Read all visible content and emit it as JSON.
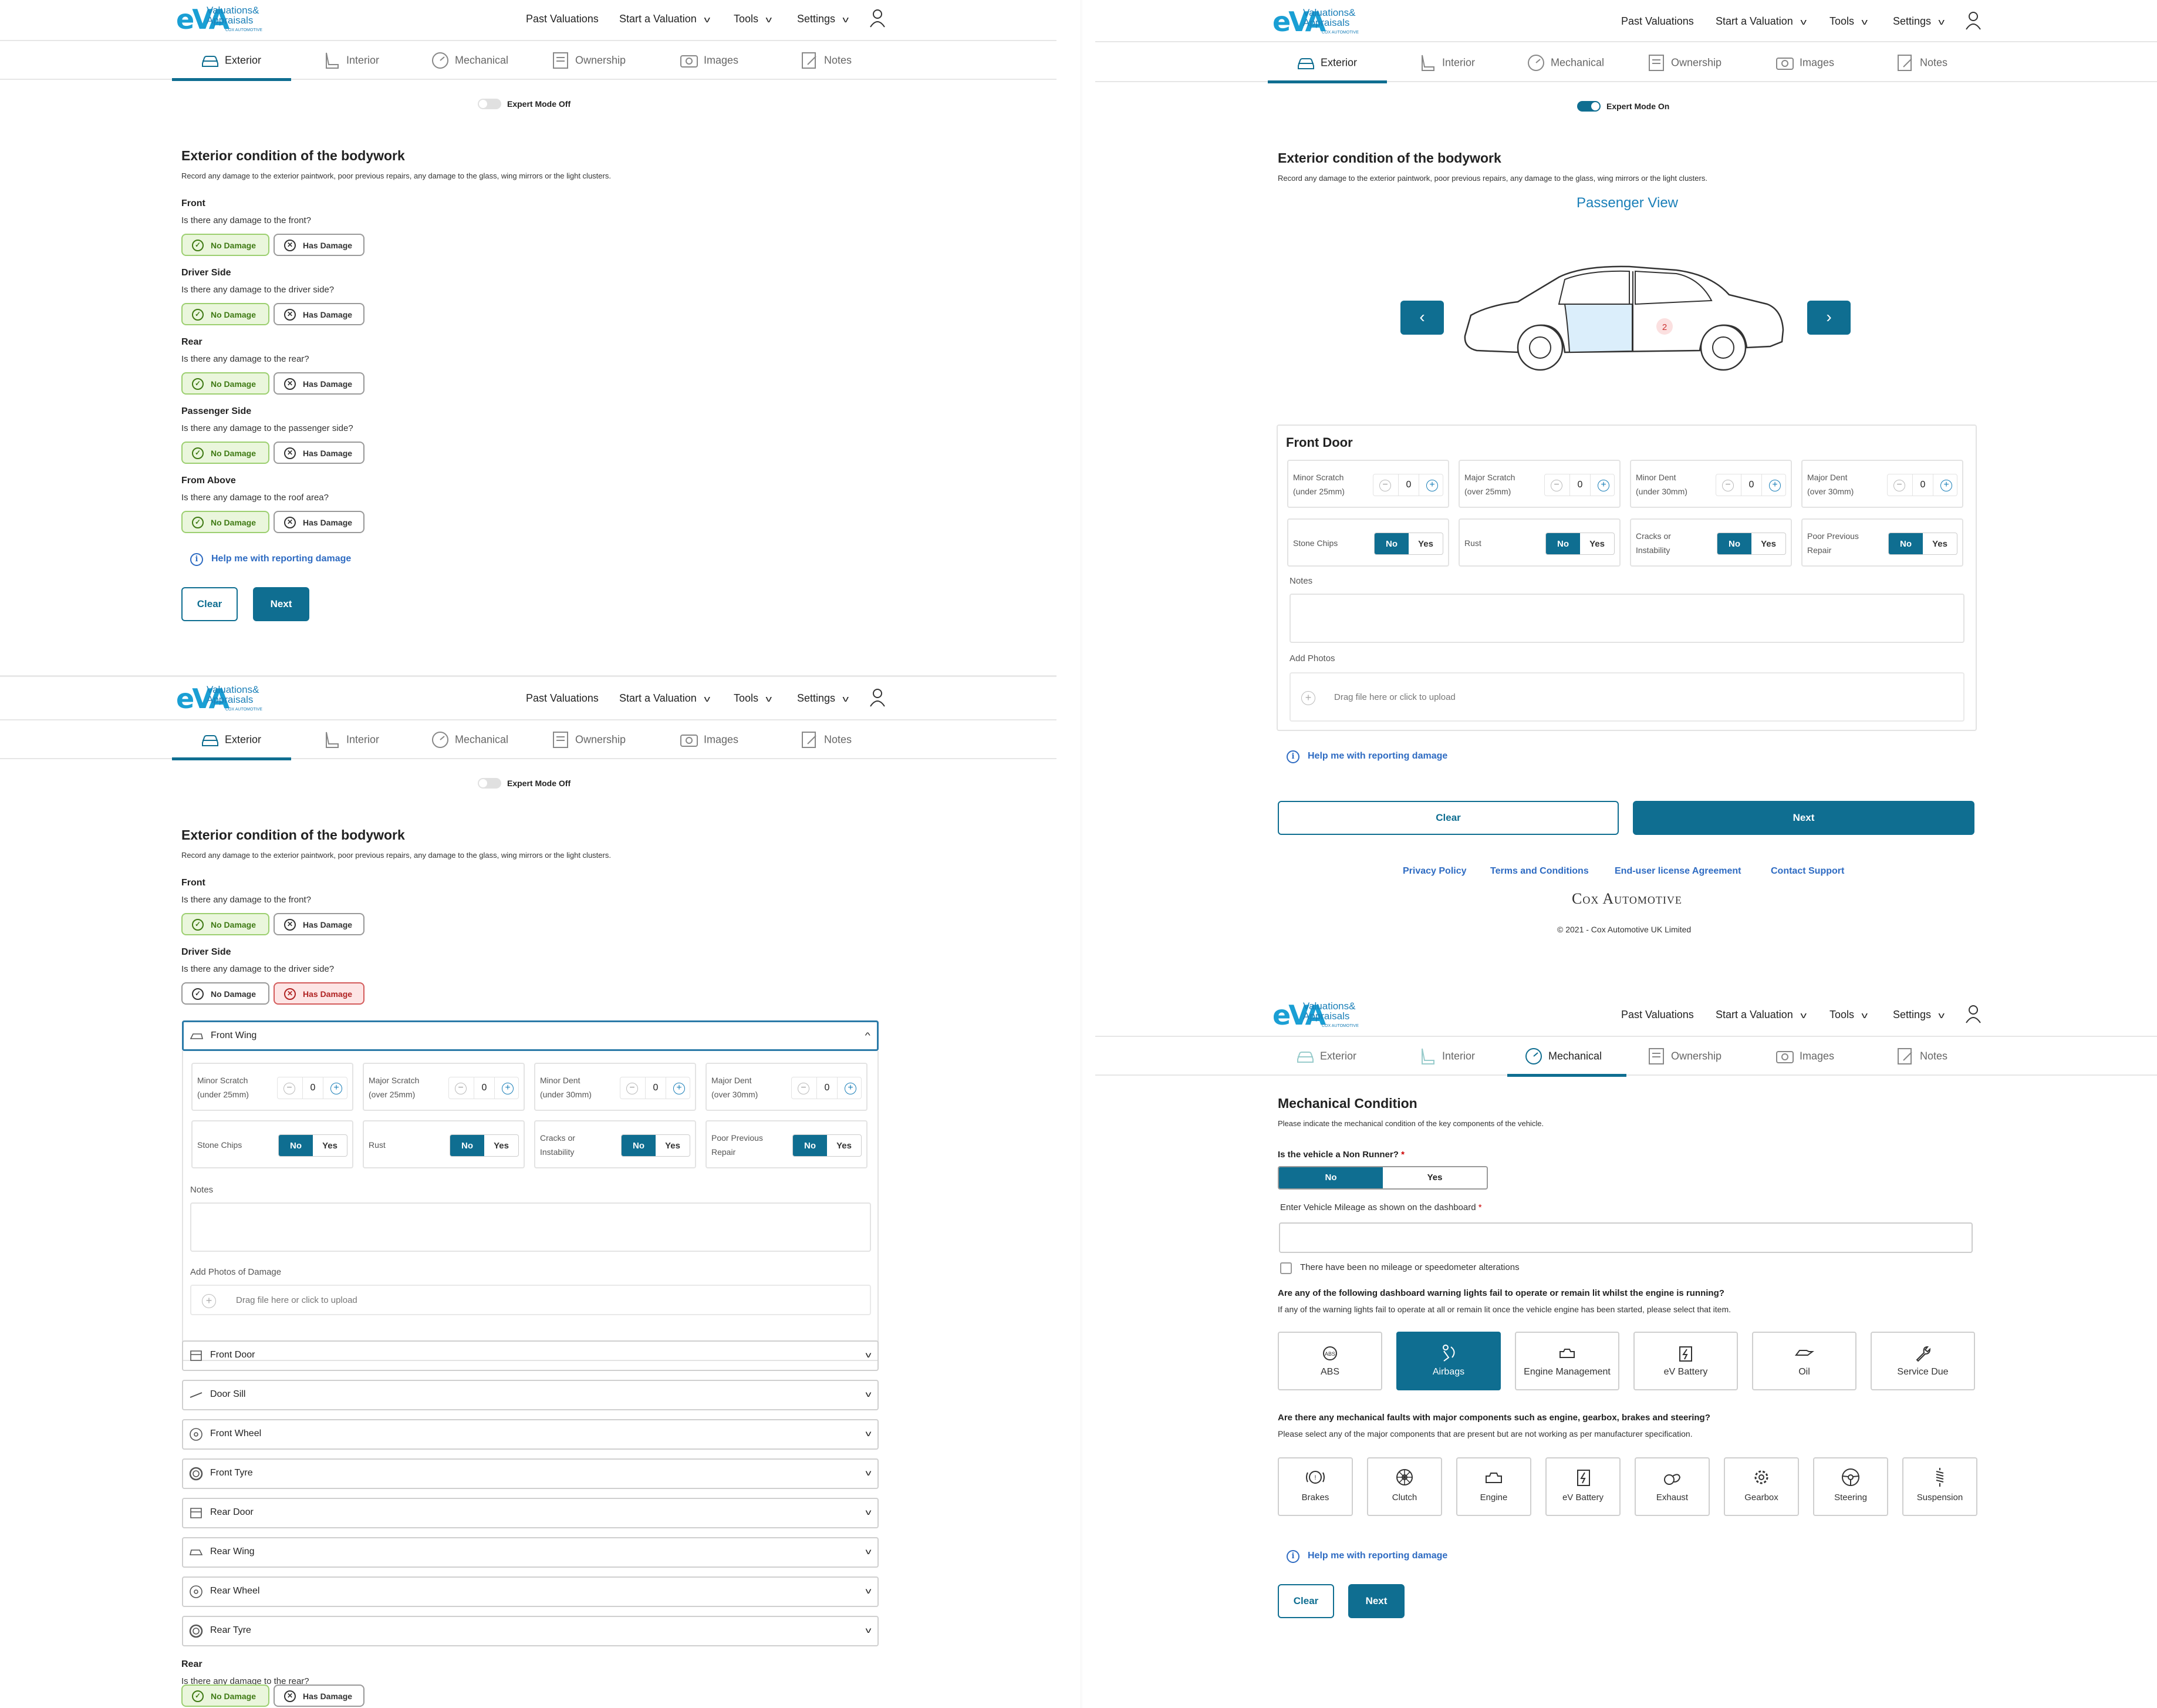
{
  "app": {
    "logo_mark": "eVA",
    "logo_text_1": "Valuations&",
    "logo_text_2": "Appraisals",
    "logo_sub": "COX AUTOMOTIVE"
  },
  "nav": {
    "past": "Past Valuations",
    "start": "Start a Valuation",
    "tools": "Tools",
    "settings": "Settings"
  },
  "tabs": {
    "exterior": "Exterior",
    "interior": "Interior",
    "mechanical": "Mechanical",
    "ownership": "Ownership",
    "images": "Images",
    "notes": "Notes"
  },
  "expert": {
    "off": "Expert Mode Off",
    "on": "Expert Mode On"
  },
  "exterior": {
    "title": "Exterior condition of the bodywork",
    "subtitle": "Record any damage to the exterior paintwork, poor previous repairs, any damage to the glass, wing mirrors or the light clusters.",
    "sections": [
      {
        "heading": "Front",
        "question": "Is there any damage to the front?"
      },
      {
        "heading": "Driver Side",
        "question": "Is there any damage to the driver side?"
      },
      {
        "heading": "Rear",
        "question": "Is there any damage to the rear?"
      },
      {
        "heading": "Passenger Side",
        "question": "Is there any damage to the passenger side?"
      },
      {
        "heading": "From Above",
        "question": "Is there any damage to the roof area?"
      }
    ],
    "no_damage": "No Damage",
    "has_damage": "Has Damage"
  },
  "help": "Help me with reporting damage",
  "clear": "Clear",
  "next": "Next",
  "damage_panel": {
    "counters": [
      {
        "l1": "Minor Scratch",
        "l2": "(under 25mm)",
        "value": "0"
      },
      {
        "l1": "Major Scratch",
        "l2": "(over 25mm)",
        "value": "0"
      },
      {
        "l1": "Minor Dent",
        "l2": "(under 30mm)",
        "value": "0"
      },
      {
        "l1": "Major Dent",
        "l2": "(over 30mm)",
        "value": "0"
      }
    ],
    "toggles": [
      {
        "l1": "Stone Chips",
        "l2": ""
      },
      {
        "l1": "Rust",
        "l2": ""
      },
      {
        "l1": "Cracks or",
        "l2": "Instability"
      },
      {
        "l1": "Poor Previous",
        "l2": "Repair"
      }
    ],
    "no": "No",
    "yes": "Yes",
    "notes": "Notes",
    "add_photos_damage": "Add Photos of Damage",
    "add_photos": "Add Photos",
    "upload": "Drag file here or click to upload"
  },
  "accordion": {
    "open": "Front Wing",
    "items": [
      "Front Door",
      "Door Sill",
      "Front Wheel",
      "Front Tyre",
      "Rear Door",
      "Rear Wing",
      "Rear Wheel",
      "Rear Tyre"
    ]
  },
  "car_view": {
    "title": "Passenger View",
    "panel": "Front Door",
    "marker": "2"
  },
  "footer": {
    "privacy": "Privacy Policy",
    "terms": "Terms and Conditions",
    "eula": "End-user license Agreement",
    "contact": "Contact Support",
    "brand": "Cox Automotive",
    "copyright": "© 2021 - Cox Automotive UK Limited"
  },
  "mechanical": {
    "title": "Mechanical Condition",
    "subtitle": "Please indicate the mechanical condition of the key components of the vehicle.",
    "non_runner_q": "Is the vehicle a Non Runner?",
    "req": "*",
    "no": "No",
    "yes": "Yes",
    "mileage_label": "Enter Vehicle Mileage as shown on the dashboard",
    "mileage_check": "There have been no mileage or speedometer alterations",
    "warn_q": "Are any of the following dashboard warning lights fail to operate or remain lit whilst the engine is running?",
    "warn_sub": "If any of the warning lights fail to operate at all or remain lit once the vehicle engine has been started, please select that item.",
    "warn_items": [
      {
        "label": "ABS",
        "icon": "abs-icon",
        "selected": false
      },
      {
        "label": "Airbags",
        "icon": "airbag-icon",
        "selected": true
      },
      {
        "label": "Engine Management",
        "icon": "engine-icon",
        "selected": false
      },
      {
        "label": "eV Battery",
        "icon": "battery-icon",
        "selected": false
      },
      {
        "label": "Oil",
        "icon": "oil-icon",
        "selected": false
      },
      {
        "label": "Service Due",
        "icon": "wrench-icon",
        "selected": false
      }
    ],
    "fault_q": "Are there any mechanical faults with major components such as engine, gearbox, brakes and steering?",
    "fault_sub": "Please select any of the major components that are present but are not working as per manufacturer specification.",
    "fault_items": [
      {
        "label": "Brakes",
        "icon": "brake-icon"
      },
      {
        "label": "Clutch",
        "icon": "clutch-icon"
      },
      {
        "label": "Engine",
        "icon": "engine-icon"
      },
      {
        "label": "eV Battery",
        "icon": "battery-icon"
      },
      {
        "label": "Exhaust",
        "icon": "exhaust-icon"
      },
      {
        "label": "Gearbox",
        "icon": "gear-icon"
      },
      {
        "label": "Steering",
        "icon": "steering-icon"
      },
      {
        "label": "Suspension",
        "icon": "suspension-icon"
      }
    ]
  },
  "colors": {
    "primary": "#0f6e91",
    "accent": "#1a9fd4",
    "success": "#eaf6dc",
    "danger": "#fde5e5",
    "link": "#2e6bc2"
  }
}
